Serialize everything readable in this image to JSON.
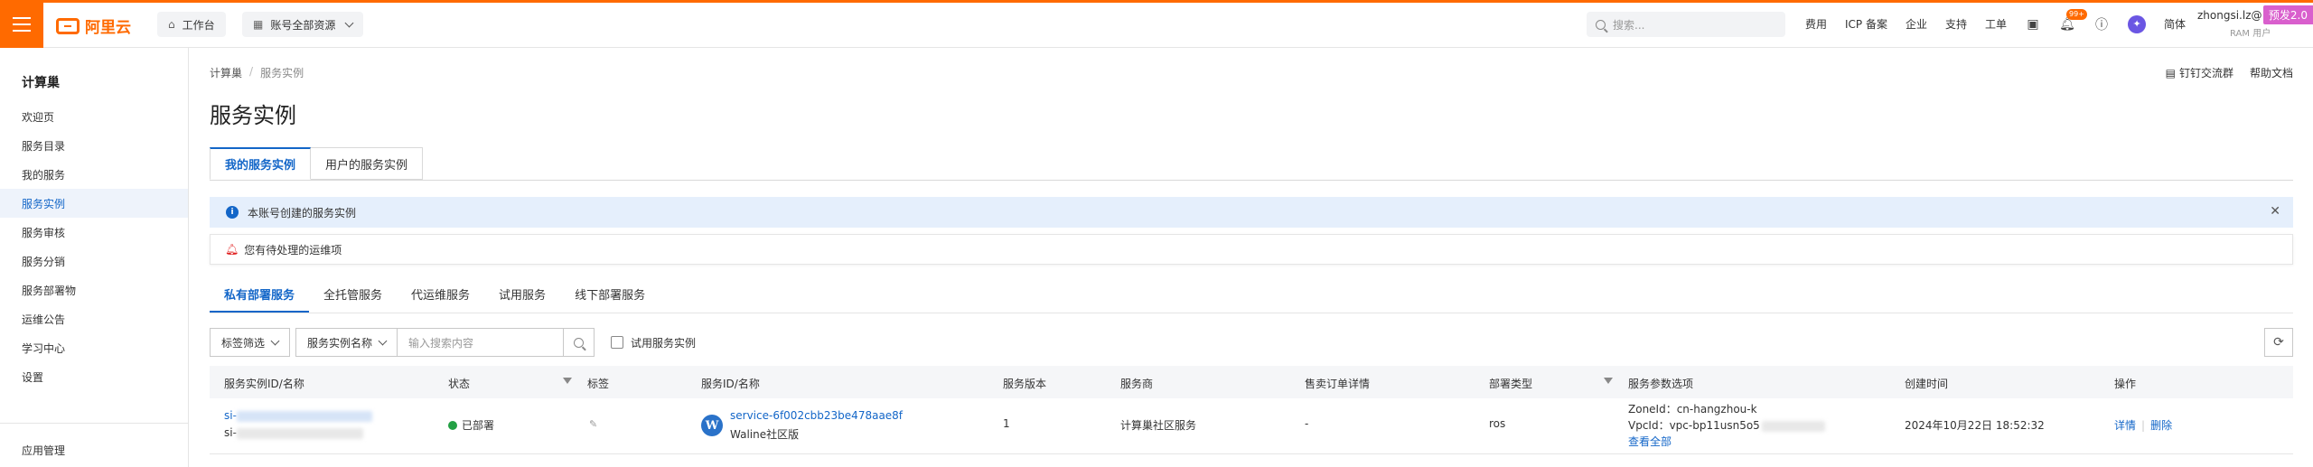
{
  "topbar": {
    "logo_text": "阿里云",
    "workbench_label": "工作台",
    "resource_label": "账号全部资源",
    "search_placeholder": "搜索...",
    "nav": [
      "费用",
      "ICP 备案",
      "企业",
      "支持",
      "工单"
    ],
    "notification_count": "99+",
    "lang_label": "简体",
    "user_name": "zhongsi.lz@",
    "user_role": "RAM 用户",
    "corner_tag": "预发2.0",
    "accent_color": "#ff6a00"
  },
  "sidebar": {
    "title": "计算巢",
    "items": [
      {
        "label": "欢迎页"
      },
      {
        "label": "服务目录"
      },
      {
        "label": "我的服务"
      },
      {
        "label": "服务实例",
        "active": true
      },
      {
        "label": "服务审核"
      },
      {
        "label": "服务分销"
      },
      {
        "label": "服务部署物"
      },
      {
        "label": "运维公告"
      },
      {
        "label": "学习中心"
      },
      {
        "label": "设置"
      }
    ],
    "bottom_item": "应用管理"
  },
  "main": {
    "breadcrumb": [
      "计算巢",
      "服务实例"
    ],
    "top_links": [
      "钉钉交流群",
      "帮助文档"
    ],
    "title": "服务实例",
    "tabs": [
      "我的服务实例",
      "用户的服务实例"
    ],
    "info_banner": "本账号创建的服务实例",
    "warn_banner": "您有待处理的运维项",
    "subtabs": [
      "私有部署服务",
      "全托管服务",
      "代运维服务",
      "试用服务",
      "线下部署服务"
    ],
    "toolbar": {
      "tag_filter": "标签筛选",
      "name_filter": "服务实例名称",
      "input_placeholder": "输入搜索内容",
      "trial_checkbox": "试用服务实例"
    },
    "table": {
      "headers": [
        "服务实例ID/名称",
        "状态",
        "标签",
        "服务ID/名称",
        "服务版本",
        "服务商",
        "售卖订单详情",
        "部署类型",
        "服务参数选项",
        "创建时间",
        "操作"
      ],
      "rows": [
        {
          "instance_id_prefix": "si-",
          "instance_name_prefix": "si-",
          "status": "已部署",
          "service_id": "service-6f002cbb23be478aae8f",
          "service_name": "Waline社区版",
          "service_logo_letter": "W",
          "version": "1",
          "provider": "计算巢社区服务",
          "order_detail": "-",
          "deploy_type": "ros",
          "param_zone": "ZoneId：cn-hangzhou-k",
          "param_vpc": "VpcId：vpc-bp11usn5o5",
          "param_more": "查看全部",
          "created": "2024年10月22日 18:52:32",
          "action_detail": "详情",
          "action_delete": "删除"
        }
      ]
    }
  }
}
